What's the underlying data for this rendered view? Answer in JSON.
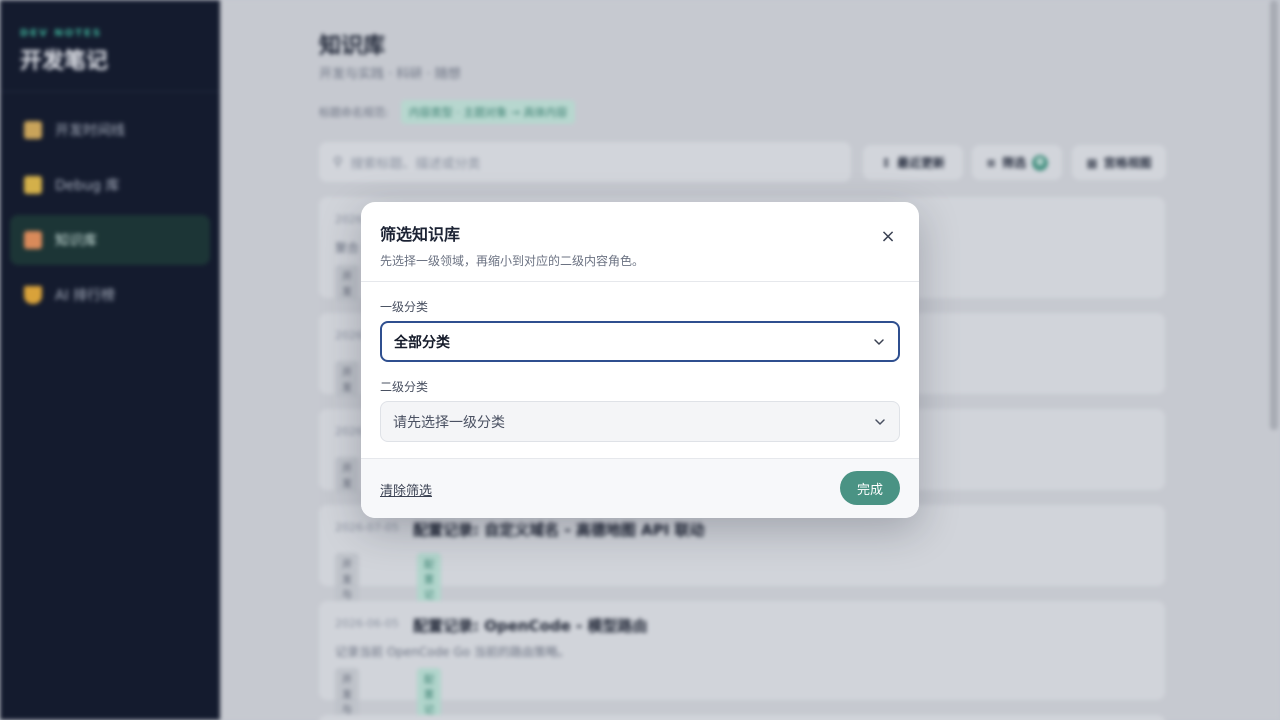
{
  "sidebar": {
    "brand_sub": "DEV NOTES",
    "brand_title": "开发笔记",
    "items": [
      {
        "label": "开发时间线",
        "icon": "person-icon",
        "active": false
      },
      {
        "label": "Debug 库",
        "icon": "notebook-icon",
        "active": false
      },
      {
        "label": "知识库",
        "icon": "books-icon",
        "active": true
      },
      {
        "label": "AI 排行榜",
        "icon": "trophy-icon",
        "active": false
      }
    ]
  },
  "header": {
    "title": "知识库",
    "subtitle": "开发与实践 · 科研 · 随想",
    "naming_label": "标题命名规范:",
    "naming_rule": "内容类型 · 主题对象 → 具体内容"
  },
  "toolbar": {
    "search_placeholder": "搜索标题、描述或分类",
    "sort_label": "最近更新",
    "filter_label": "筛选",
    "filter_count": "0",
    "view_label": "宫格视图"
  },
  "cards": [
    {
      "date": "2026",
      "title": "",
      "desc": "聚合",
      "tags": [
        "开发"
      ]
    },
    {
      "date": "2026",
      "title": "",
      "desc": "",
      "tags": [
        "开发"
      ]
    },
    {
      "date": "2026",
      "title": "",
      "desc": "",
      "tags": [
        "开发"
      ]
    },
    {
      "date": "2026-07-05",
      "title": "配置记录: 自定义域名 - 高德地图 API 联动",
      "desc": "",
      "tags": [
        "开发与实践",
        "配置记录"
      ]
    },
    {
      "date": "2026-06-05",
      "title": "配置记录: OpenCode - 模型路由",
      "desc": "记录当前 OpenCode Go 当前的路由策略。",
      "tags": [
        "开发与实践",
        "配置记录"
      ]
    }
  ],
  "modal": {
    "title": "筛选知识库",
    "description": "先选择一级领域，再缩小到对应的二级内容角色。",
    "level1_label": "一级分类",
    "level1_value": "全部分类",
    "level2_label": "二级分类",
    "level2_value": "请先选择一级分类",
    "clear_label": "清除筛选",
    "done_label": "完成",
    "close_symbol": "×"
  },
  "colors": {
    "accent": "#4a9384",
    "sidebar_bg": "#141b2e",
    "focus_border": "#2f4f8f"
  }
}
